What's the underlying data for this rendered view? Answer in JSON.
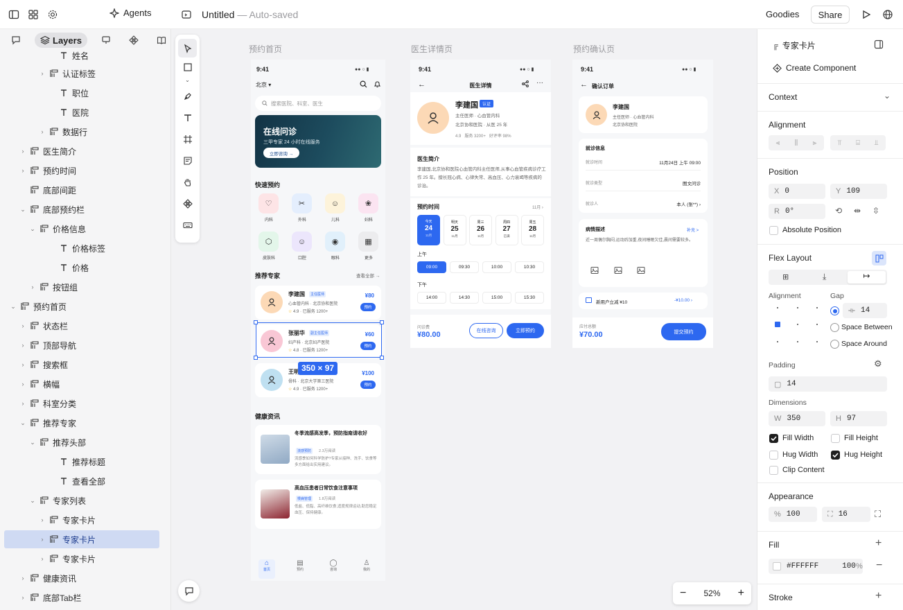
{
  "topbar": {
    "agents": "Agents",
    "title": "Untitled",
    "subtitle": " — Auto-saved",
    "goodies": "Goodies",
    "share": "Share"
  },
  "left": {
    "tabs": {
      "layers": "Layers"
    },
    "layers": [
      {
        "label": "姓名",
        "icon": "text"
      },
      {
        "label": "认证标签",
        "icon": "frame"
      },
      {
        "label": "职位",
        "icon": "text"
      },
      {
        "label": "医院",
        "icon": "text"
      },
      {
        "label": "数据行",
        "icon": "frame"
      },
      {
        "label": "医生简介",
        "icon": "frame"
      },
      {
        "label": "预约时间",
        "icon": "frame"
      },
      {
        "label": "底部间距",
        "icon": "frame"
      },
      {
        "label": "底部预约栏",
        "icon": "frame"
      },
      {
        "label": "价格信息",
        "icon": "frame"
      },
      {
        "label": "价格标签",
        "icon": "text"
      },
      {
        "label": "价格",
        "icon": "text"
      },
      {
        "label": "按钮组",
        "icon": "frame"
      },
      {
        "label": "预约首页",
        "icon": "frame"
      },
      {
        "label": "状态栏",
        "icon": "frame"
      },
      {
        "label": "顶部导航",
        "icon": "frame"
      },
      {
        "label": "搜索框",
        "icon": "frame"
      },
      {
        "label": "横幅",
        "icon": "frame"
      },
      {
        "label": "科室分类",
        "icon": "frame"
      },
      {
        "label": "推荐专家",
        "icon": "frame"
      },
      {
        "label": "推荐头部",
        "icon": "frame"
      },
      {
        "label": "推荐标题",
        "icon": "text"
      },
      {
        "label": "查看全部",
        "icon": "text"
      },
      {
        "label": "专家列表",
        "icon": "frame"
      },
      {
        "label": "专家卡片",
        "icon": "frame"
      },
      {
        "label": "专家卡片",
        "icon": "frame"
      },
      {
        "label": "专家卡片",
        "icon": "frame"
      },
      {
        "label": "健康资讯",
        "icon": "frame"
      },
      {
        "label": "底部Tab栏",
        "icon": "frame"
      }
    ]
  },
  "canvas": {
    "frame1": {
      "title": "预约首页",
      "time": "9:41",
      "city": "北京",
      "search": "搜索医院、科室、医生",
      "banner_title": "在线问诊",
      "banner_sub": "三甲专家 24 小时在线服务",
      "banner_btn": "立即咨询 →",
      "quick_title": "快速预约",
      "depts": [
        "内科",
        "外科",
        "儿科",
        "妇科",
        "皮肤科",
        "口腔",
        "眼科",
        "更多"
      ],
      "rec_title": "推荐专家",
      "view_all": "查看全部 →",
      "experts": [
        {
          "name": "李建国",
          "tag": "主任医师",
          "dept": "心血管内科 · 北京协和医院",
          "rating": "4.9 · 已服务 1200+",
          "price": "¥80",
          "btn": "预约"
        },
        {
          "name": "张丽华",
          "tag": "副主任医师",
          "dept": "妇产科 · 北京妇产医院",
          "rating": "4.8 · 已服务 1200+",
          "price": "¥60",
          "btn": "预约"
        },
        {
          "name": "王明",
          "tag": "",
          "dept": "骨科 · 北京大学第三医院",
          "rating": "4.9 · 已服务 1200+",
          "price": "¥100",
          "btn": "预约"
        }
      ],
      "size_badge": "350 × 97",
      "news_title": "健康资讯",
      "news": [
        {
          "title": "冬季流感高发季，预防指南请收好",
          "tag": "流感预防",
          "views": "2.3万阅读",
          "desc": "流感季如何科学防护?专家从接种、洗手、饮食等多方面给出实用建议。"
        },
        {
          "title": "高血压患者日常饮食注意事项",
          "tag": "慢病管理",
          "views": "1.8万阅读",
          "desc": "低盐、低脂、高纤维饮食,适度规律运动,助您稳定血压、保持健康。"
        }
      ],
      "tabs": [
        "首页",
        "预约",
        "咨询",
        "我的"
      ]
    },
    "frame2": {
      "title": "医生详情页",
      "time": "9:41",
      "header": "医生详情",
      "name": "李建国",
      "badge": "认证",
      "role": "主任医师 · 心血管内科",
      "hospital": "北京协和医院 · 从医 25 年",
      "stats": "4.9   服务 3200+   好评率 98%",
      "intro_title": "医生简介",
      "intro": "李建国,北京协和医院心血管内科主任医师,从事心血管疾病诊疗工作 25 年。擅长冠心病、心律失常、高血压、心力衰竭等疾病的诊治。",
      "time_title": "预约时间",
      "month": "11月 ›",
      "days": [
        {
          "w": "今天",
          "d": "24",
          "n": "11月"
        },
        {
          "w": "明天",
          "d": "25",
          "n": "11月"
        },
        {
          "w": "周三",
          "d": "26",
          "n": "11月"
        },
        {
          "w": "周四",
          "d": "27",
          "n": "已满"
        },
        {
          "w": "周五",
          "d": "28",
          "n": "11月"
        }
      ],
      "am": "上午",
      "am_slots": [
        "09:00",
        "09:30",
        "10:00",
        "10:30"
      ],
      "pm": "下午",
      "pm_slots": [
        "14:00",
        "14:30",
        "15:00",
        "15:30"
      ],
      "fee_label": "问诊费",
      "fee": "¥80.00",
      "btn_consult": "在线咨询",
      "btn_book": "立即预约"
    },
    "frame3": {
      "title": "预约确认页",
      "time": "9:41",
      "header": "确认订单",
      "name": "李建国",
      "role": "主任医师 · 心血管内科",
      "hospital": "北京协和医院",
      "info_title": "就诊信息",
      "rows": [
        {
          "k": "就诊时间",
          "v": "11月24日 上午 09:00"
        },
        {
          "k": "就诊类型",
          "v": "图文问诊"
        },
        {
          "k": "就诊人",
          "v": "本人 (张**) ›"
        }
      ],
      "desc_title": "病情描述",
      "desc_more": "补充 >",
      "desc": "近一周偶尔胸闷,运动后加重,夜间睡眠欠佳,晨间需要较多。",
      "coupon": "新用户立减 ¥10",
      "coupon_val": "-¥10.00 ›",
      "total_label": "应付总额",
      "total": "¥70.00",
      "submit": "提交预约"
    },
    "zoom": "52%"
  },
  "right": {
    "component": "专家卡片",
    "create_component": "Create Component",
    "context": "Context",
    "alignment": "Alignment",
    "position": "Position",
    "x": "0",
    "y": "109",
    "r": "0°",
    "absolute": "Absolute Position",
    "flex": "Flex Layout",
    "flex_align": "Alignment",
    "gap": "Gap",
    "gap_val": "14",
    "space_between": "Space Between",
    "space_around": "Space Around",
    "padding": "Padding",
    "padding_val": "14",
    "dimensions": "Dimensions",
    "w": "350",
    "h": "97",
    "fill_width": "Fill Width",
    "fill_height": "Fill Height",
    "hug_width": "Hug Width",
    "hug_height": "Hug Height",
    "clip": "Clip Content",
    "appearance": "Appearance",
    "opacity": "100",
    "radius": "16",
    "fill": "Fill",
    "fill_hex": "#FFFFFF",
    "fill_op": "100",
    "pct": "%",
    "stroke": "Stroke"
  },
  "colors": {
    "accent": "#2d68f0",
    "selection": "#cfdaf3"
  }
}
